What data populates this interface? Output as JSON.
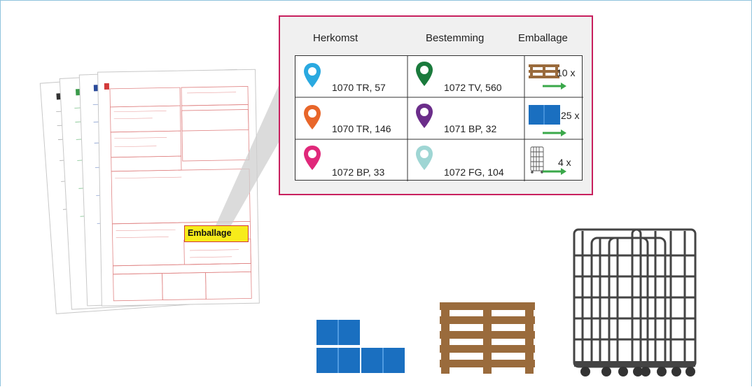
{
  "form": {
    "field_label": "Emballage"
  },
  "table": {
    "headers": {
      "origin": "Herkomst",
      "destination": "Bestemming",
      "packaging": "Emballage"
    },
    "rows": [
      {
        "origin": "1070 TR, 57",
        "origin_pin_color": "#2aa9e0",
        "destination": "1072 TV, 560",
        "destination_pin_color": "#1a7a3c",
        "packaging_icon": "pallet-icon",
        "quantity": "10 x"
      },
      {
        "origin": "1070 TR, 146",
        "origin_pin_color": "#e8662a",
        "destination": "1071 BP, 32",
        "destination_pin_color": "#6b2d8a",
        "packaging_icon": "crate-icon",
        "quantity": "25 x"
      },
      {
        "origin": "1072 BP, 33",
        "origin_pin_color": "#e0287a",
        "destination": "1072 FG, 104",
        "destination_pin_color": "#9fd6d4",
        "packaging_icon": "roll-cage-icon",
        "quantity": "4 x"
      }
    ]
  },
  "colors": {
    "border_accent": "#c8205e",
    "arrow": "#3aa84a",
    "crate_blue": "#1a6fc0",
    "pallet_brown": "#9a6b3c",
    "cage_gray": "#444444"
  }
}
